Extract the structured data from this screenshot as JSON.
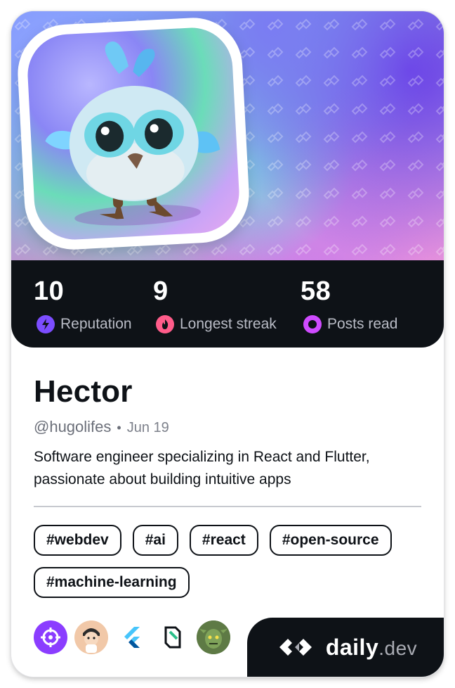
{
  "profile": {
    "name": "Hector",
    "handle": "@hugolifes",
    "separator": "•",
    "joined": "Jun 19",
    "bio": "Software engineer specializing in React and Flutter, passionate about building intuitive apps"
  },
  "stats": [
    {
      "value": "10",
      "label": "Reputation",
      "icon": "lightning-icon",
      "color": "#7c4dff"
    },
    {
      "value": "9",
      "label": "Longest streak",
      "icon": "flame-icon",
      "color": "#ff5c8a"
    },
    {
      "value": "58",
      "label": "Posts read",
      "icon": "ring-icon",
      "color": "#cf4bff"
    }
  ],
  "tags": [
    "#webdev",
    "#ai",
    "#react",
    "#open-source",
    "#machine-learning"
  ],
  "stack": [
    "target-icon",
    "memoji-avatar",
    "flutter-icon",
    "supabase-like-icon",
    "goblin-avatar"
  ],
  "brand": {
    "name": "daily",
    "suffix": ".dev"
  },
  "colors": {
    "dark": "#0e1217",
    "muted": "#6b6f79",
    "accent_purple": "#8b3dff"
  }
}
